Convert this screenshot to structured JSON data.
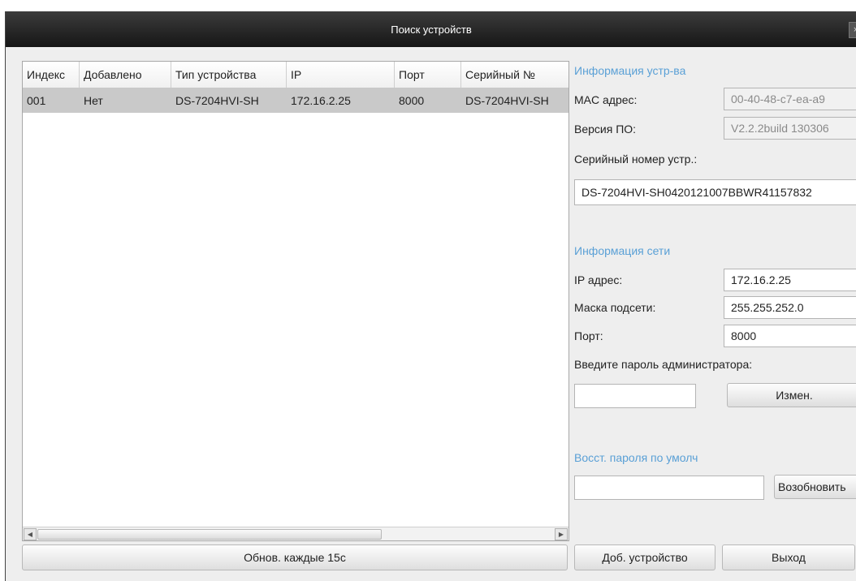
{
  "window": {
    "title": "Поиск устройств",
    "close_glyph": "×"
  },
  "table": {
    "columns": [
      "Индекс",
      "Добавлено",
      "Тип устройства",
      "IP",
      "Порт",
      "Серийный №"
    ],
    "rows": [
      [
        "001",
        "Нет",
        "DS-7204HVI-SH",
        "172.16.2.25",
        "8000",
        "DS-7204HVI-SH"
      ]
    ],
    "scroll_left_glyph": "◀",
    "scroll_right_glyph": "▶"
  },
  "device_info": {
    "title": "Информация устр-ва",
    "mac_label": "MAC адрес:",
    "mac_value": "00-40-48-c7-ea-a9",
    "fw_label": "Версия ПО:",
    "fw_value": "V2.2.2build 130306",
    "serial_label": "Серийный номер устр.:",
    "serial_value": "DS-7204HVI-SH0420121007BBWR41157832"
  },
  "network_info": {
    "title": "Информация сети",
    "ip_label": "IP адрес:",
    "ip_value": "172.16.2.25",
    "mask_label": "Маска подсети:",
    "mask_value": "255.255.252.0",
    "port_label": "Порт:",
    "port_value": "8000",
    "admin_password_label": "Введите пароль администратора:",
    "admin_password_value": "",
    "change_button": "Измен."
  },
  "restore": {
    "title": "Восст. пароля по умолч",
    "value": "",
    "renew_button": "Возобновить"
  },
  "footer": {
    "refresh_button": "Обнов. каждые 15с",
    "add_device_button": "Доб. устройство",
    "exit_button": "Выход"
  },
  "colors": {
    "section_title": "#5aa0d6",
    "selected_row": "#c9c9c9",
    "titlebar": "#1e1e1e"
  }
}
